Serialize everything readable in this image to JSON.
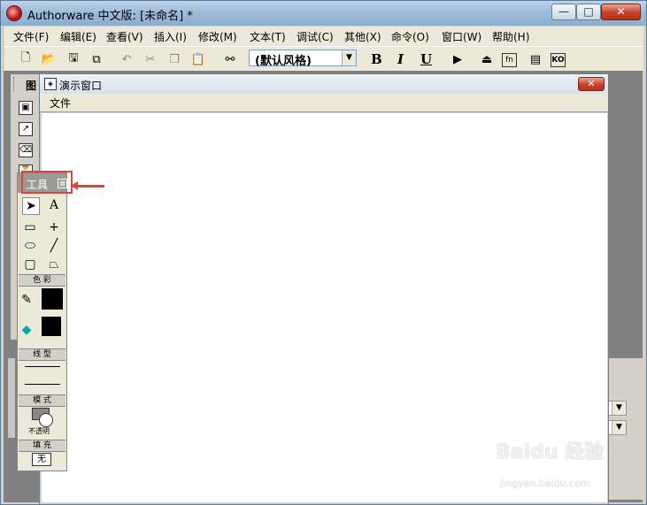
{
  "window": {
    "title": "Authorware 中文版: [未命名] *",
    "min_label": "—",
    "max_label": "□",
    "close_label": "✕"
  },
  "menubar": {
    "items": [
      "文件(F)",
      "编辑(E)",
      "查看(V)",
      "插入(I)",
      "修改(M)",
      "文本(T)",
      "调试(C)",
      "其他(X)",
      "命令(O)",
      "窗口(W)",
      "帮助(H)"
    ]
  },
  "toolbar": {
    "style_value": "(默认风格)",
    "bold_label": "B",
    "italic_label": "I",
    "underline_label": "U",
    "fn_label": "fn",
    "ko_label": "KO"
  },
  "icon_palette": {
    "header": "图"
  },
  "presentation_window": {
    "title": "演示窗口",
    "menu_file": "文件",
    "close_label": "✕"
  },
  "tools_panel": {
    "title": "工具",
    "close_label": "⊠",
    "section_color": "色 彩",
    "section_line": "线 型",
    "section_mode": "模 式",
    "mode_value": "不透明",
    "section_fill": "填 充",
    "fill_value": "无",
    "text_tool_label": "A"
  },
  "watermark": {
    "text": "Baidu 经验",
    "sub": "jingyan.baidu.com"
  },
  "colors": {
    "highlight": "#d9473e",
    "close_red": "#c8412a"
  }
}
